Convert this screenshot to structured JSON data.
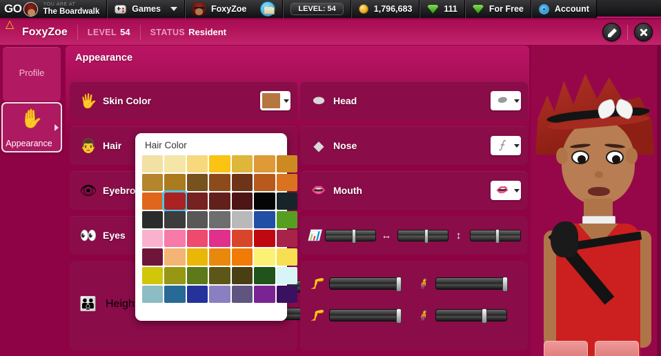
{
  "topbar": {
    "go_label": "GO",
    "location_small": "YOU ARE AT",
    "location_big": "The Boardwalk",
    "games_label": "Games",
    "user_label": "FoxyZoe",
    "level_pill": "LEVEL: 54",
    "coins": "1,796,683",
    "gems": "111",
    "for_free": "For Free",
    "account": "Account",
    "icons": {
      "go_avatar": "user-avatar-icon",
      "gamepad": "gamepad-icon",
      "caret": "chevron-down-icon",
      "mail": "envelope-icon",
      "coin": "coin-icon",
      "gem": "gem-icon",
      "gift": "gift-gem-icon",
      "gear": "gear-icon"
    }
  },
  "subheader": {
    "username": "FoxyZoe",
    "level_key": "LEVEL",
    "level_value": "54",
    "status_key": "STATUS",
    "status_value": "Resident",
    "edit_icon": "edit-pencil-icon",
    "close_icon": "close-icon"
  },
  "sidebar": {
    "items": [
      {
        "label": "Profile",
        "icon": "profile-icon",
        "active": false
      },
      {
        "label": "Appearance",
        "icon": "hand-icon",
        "active": true
      }
    ]
  },
  "panel": {
    "title": "Appearance",
    "left_rows": [
      {
        "label": "Skin Color",
        "icon": "hand-icon",
        "swatch": "#b5763f",
        "type": "color"
      },
      {
        "label": "Hair",
        "icon": "hair-icon",
        "type": "picker"
      },
      {
        "label": "Eyebrows",
        "icon": "eyebrow-icon",
        "type": "picker"
      },
      {
        "label": "Eyes",
        "icon": "eye-icon",
        "type": "picker"
      },
      {
        "label": "Height & Body",
        "icon": "body-icon",
        "type": "sliders"
      }
    ],
    "right_rows": [
      {
        "label": "Head",
        "icon": "head-icon",
        "type": "picker"
      },
      {
        "label": "Nose",
        "icon": "nose-icon",
        "type": "picker"
      },
      {
        "label": "Mouth",
        "icon": "mouth-icon",
        "type": "picker"
      }
    ],
    "face_sliders": [
      {
        "icon": "bars-icon",
        "value": 52
      },
      {
        "icon": "arrows-horizontal-icon",
        "value": 52
      },
      {
        "icon": "arrows-vertical-icon",
        "value": 50
      }
    ],
    "body_sliders": [
      {
        "icon": "leg-upper-icon",
        "value": 96
      },
      {
        "icon": "leg-lower-icon",
        "value": 96
      },
      {
        "icon": "body-tall-icon",
        "value": 96
      },
      {
        "icon": "body-short-icon",
        "value": 66
      }
    ]
  },
  "color_popup": {
    "title": "Hair Color",
    "selected_index": 15,
    "columns": 7,
    "colors": [
      "#f3e0a4",
      "#f5e6a8",
      "#f7d87a",
      "#fbc312",
      "#ddb63a",
      "#dd9a37",
      "#cd8a20",
      "#b4852c",
      "#ab7b20",
      "#77521d",
      "#8d4b1c",
      "#6e3418",
      "#b85a1c",
      "#d9731f",
      "#e0661b",
      "#ab2222",
      "#762220",
      "#62201c",
      "#4d1516",
      "#050505",
      "#17242a",
      "#2b2b2b",
      "#3c3c3c",
      "#585858",
      "#6e6e6e",
      "#b9b9b9",
      "#214fa5",
      "#569e1f",
      "#f9b2cd",
      "#f87aa9",
      "#ed4a6e",
      "#e0308c",
      "#d9452a",
      "#c00811",
      "#a8234a",
      "#6f1539",
      "#f3b574",
      "#e8b708",
      "#e8890d",
      "#f07c07",
      "#fbf172",
      "#f7df52",
      "#d1c60a",
      "#989713",
      "#5c7a19",
      "#5c5617",
      "#4a3e13",
      "#20541b",
      "#d7f4f7",
      "#8cbcc4",
      "#276a96",
      "#25329b",
      "#8a7fc0",
      "#5f5580",
      "#7a2393",
      "#3a1160"
    ]
  },
  "avatar": {
    "name": "avatar-preview",
    "hair_color": "#b8342a",
    "skin_color": "#b87d53",
    "top_color": "#cc1f1f"
  },
  "footer_buttons": [
    {
      "name": "footer-button-1"
    },
    {
      "name": "footer-button-2"
    }
  ]
}
